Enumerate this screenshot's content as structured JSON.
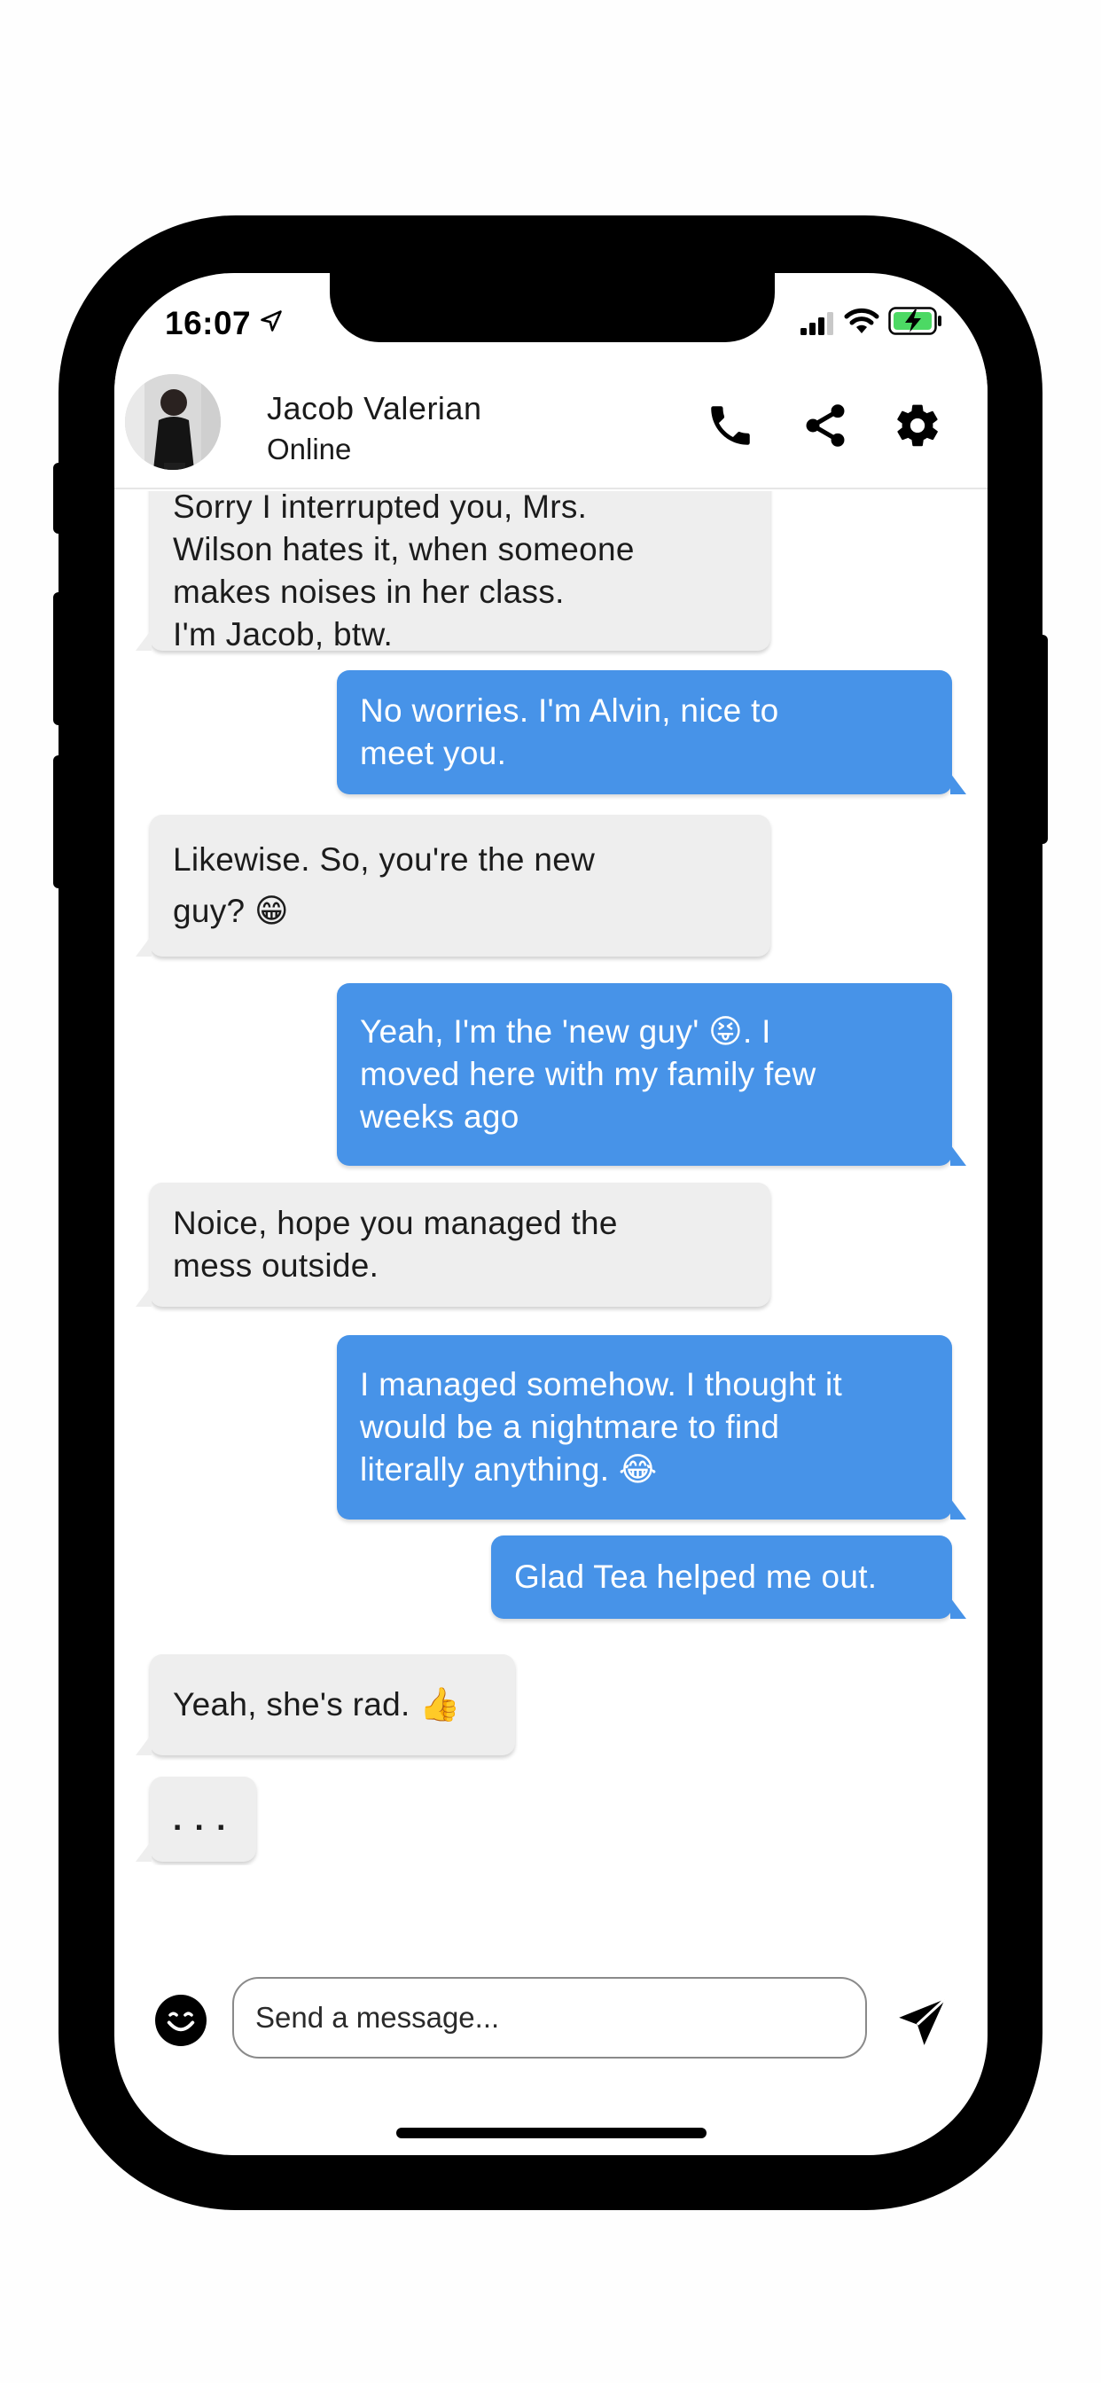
{
  "status_bar": {
    "time": "16:07",
    "icons": [
      "location-arrow-icon",
      "signal-icon",
      "wifi-icon",
      "battery-charging-icon"
    ],
    "battery_color": "#4cd964"
  },
  "header": {
    "contact_name": "Jacob Valerian",
    "contact_status": "Online",
    "actions": [
      "phone-icon",
      "share-icon",
      "gear-icon"
    ]
  },
  "messages": [
    {
      "from": "contact",
      "text": "Sorry I interrupted you, Mrs.\nWilson hates it, when someone\nmakes noises in her class.\nI'm Jacob, btw."
    },
    {
      "from": "me",
      "text": "No worries. I'm Alvin, nice to\nmeet you."
    },
    {
      "from": "contact",
      "text": "Likewise. So, you're the new\nguy? 😁"
    },
    {
      "from": "me",
      "text": "Yeah, I'm the 'new guy' 😝. I\nmoved here with my family few\nweeks ago"
    },
    {
      "from": "contact",
      "text": "Noice, hope you managed the\nmess outside."
    },
    {
      "from": "me",
      "text": "I managed somehow. I thought it\nwould be a nightmare to find\nliterally anything. 😂"
    },
    {
      "from": "me",
      "text": "Glad Tea helped me out."
    },
    {
      "from": "contact",
      "text": "Yeah, she's rad. 👍"
    },
    {
      "from": "contact",
      "text": ". . ."
    }
  ],
  "composer": {
    "placeholder": "Send a message...",
    "emoji_icon": "smiley-icon",
    "send_icon": "paper-plane-icon"
  },
  "colors": {
    "outgoing_bubble": "#4793e8",
    "incoming_bubble": "#eeeeee"
  }
}
